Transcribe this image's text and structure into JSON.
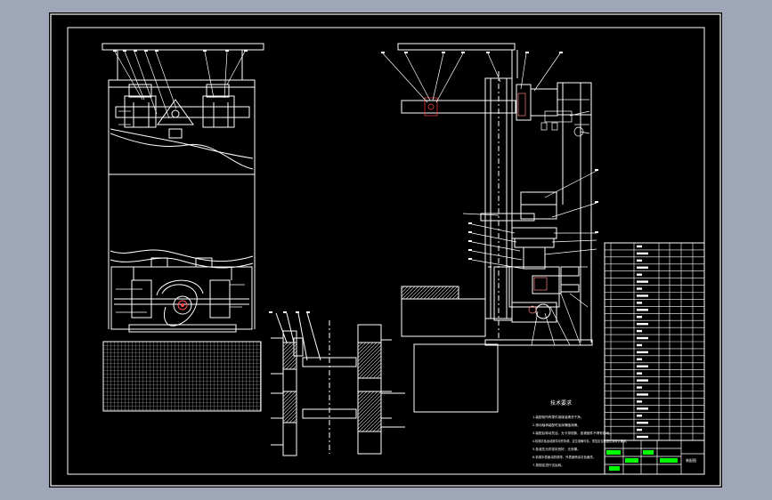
{
  "drawing": {
    "notes_title": "技术要求",
    "notes": [
      "1.装配前所有零件用煤油清洗干净。",
      "2.滚动轴承装配时加润滑脂润滑。",
      "3.装配后转动灵活，无卡滞现象，各紧固件不得有松动。",
      "4.机械手各运动部件动作协调，定位准确可靠，重复定位精度达到设计要求。",
      "5.各液压元件密封良好，无渗漏。",
      "6.机械手表面涂防锈漆，外表面喷涂灰色面漆。",
      "7.按规定进行试运转。"
    ],
    "title_block_text": "装配图"
  },
  "colors": {
    "background": "#9ea6b8",
    "sheet": "#000000",
    "line": "#ffffff",
    "accent": "#00ff00",
    "hatch": "#c8c8c8"
  }
}
